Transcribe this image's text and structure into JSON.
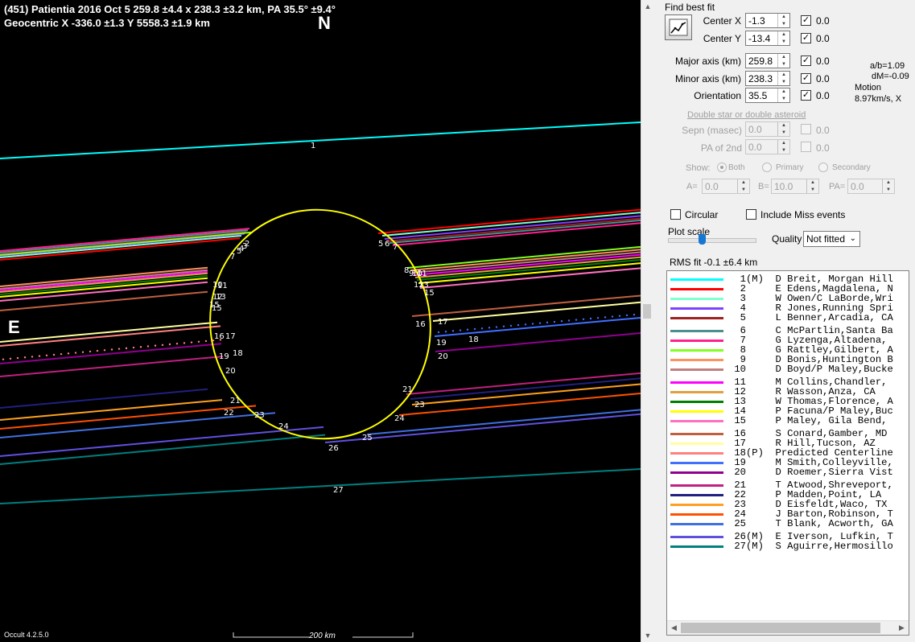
{
  "plot": {
    "title_line1": "(451) Patientia  2016 Oct 5   259.8 ±4.4 x 238.3 ±3.2 km,  PA 35.5° ±9.4°",
    "title_line2": "Geocentric  X  -336.0 ±1.3  Y 5558.3 ±1.9 km",
    "north": "N",
    "east": "E",
    "version": "Occult 4.2.5.0",
    "scale": "200 km",
    "chord_labels": [
      "1",
      "2",
      "3",
      "4",
      "5",
      "6",
      "7",
      "8",
      "9",
      "10",
      "11",
      "12",
      "13",
      "14",
      "15",
      "16",
      "17",
      "18",
      "19",
      "20",
      "21",
      "22",
      "23",
      "24",
      "25",
      "26",
      "27"
    ]
  },
  "panel": {
    "find_best_fit": "Find best fit",
    "center_x": {
      "label": "Center X",
      "value": "-1.3",
      "fit": "0.0"
    },
    "center_y": {
      "label": "Center Y",
      "value": "-13.4",
      "fit": "0.0"
    },
    "major_axis": {
      "label": "Major axis (km)",
      "value": "259.8",
      "fit": "0.0"
    },
    "minor_axis": {
      "label": "Minor axis (km)",
      "value": "238.3",
      "fit": "0.0"
    },
    "orientation": {
      "label": "Orientation",
      "value": "35.5",
      "fit": "0.0"
    },
    "ab_ratio": "a/b=1.09",
    "dm": "dM=-0.09",
    "motion_label": "Motion",
    "motion_value": "8.97km/s, X",
    "double_star_link": "Double star  or  double asteroid",
    "sepn": {
      "label": "Sepn (masec)",
      "value": "0.0",
      "fit": "0.0"
    },
    "pa2nd": {
      "label": "PA of 2nd",
      "value": "0.0",
      "fit": "0.0"
    },
    "show_label": "Show:",
    "show_options": [
      "Both",
      "Primary",
      "Secondary"
    ],
    "a_label": "A=",
    "a_value": "0.0",
    "b_label": "B=",
    "b_value": "10.0",
    "pa_label": "PA=",
    "pa_value": "0.0",
    "circular": "Circular",
    "include_miss": "Include Miss events",
    "plot_scale": "Plot scale",
    "quality_label": "Quality",
    "quality_value": "Not fitted",
    "rms_fit": "RMS fit -0.1 ±6.4 km"
  },
  "legend": [
    {
      "text": "  1(M)  D Breit, Morgan Hill",
      "color": "#00ffff"
    },
    {
      "text": "  2     E Edens,Magdalena, N",
      "color": "#ff0000"
    },
    {
      "text": "  3     W Owen/C LaBorde,Wri",
      "color": "#80ffd0"
    },
    {
      "text": "  4     R Jones,Running Spri",
      "color": "#8040ff"
    },
    {
      "text": "  5     L Benner,Arcadia, CA",
      "color": "#a02020"
    },
    {
      "text": "  6     C McPartlin,Santa Ba",
      "color": "#4a9090"
    },
    {
      "text": "  7     G Lyzenga,Altadena,",
      "color": "#ff2090"
    },
    {
      "text": "  8     G Rattley,Gilbert, A",
      "color": "#80ff20"
    },
    {
      "text": "  9     D Bonis,Huntington B",
      "color": "#ff9060"
    },
    {
      "text": " 10     D Boyd/P Maley,Bucke",
      "color": "#c08080"
    },
    {
      "text": " 11     M Collins,Chandler,",
      "color": "#ff00ff"
    },
    {
      "text": " 12     R Wasson,Anza, CA",
      "color": "#e0a040"
    },
    {
      "text": " 13     W Thomas,Florence, A",
      "color": "#008000"
    },
    {
      "text": " 14     P Facuna/P Maley,Buc",
      "color": "#ffff00"
    },
    {
      "text": " 15     P Maley, Gila Bend,",
      "color": "#ff70c0"
    },
    {
      "text": " 16     S Conard,Gamber, MD",
      "color": "#c06040"
    },
    {
      "text": " 17     R Hill,Tucson, AZ",
      "color": "#ffffa0"
    },
    {
      "text": " 18(P)  Predicted Centerline",
      "color": "#ff8080"
    },
    {
      "text": " 19     M Smith,Colleyville,",
      "color": "#4070ff"
    },
    {
      "text": " 20     D Roemer,Sierra Vist",
      "color": "#900090"
    },
    {
      "text": " 21     T Atwood,Shreveport,",
      "color": "#c02080"
    },
    {
      "text": " 22     P Madden,Point, LA",
      "color": "#202080"
    },
    {
      "text": " 23     D Eisfeldt,Waco, TX",
      "color": "#ffa020"
    },
    {
      "text": " 24     J Barton,Robinson, T",
      "color": "#ff5000"
    },
    {
      "text": " 25     T Blank, Acworth, GA",
      "color": "#4070e0"
    },
    {
      "text": " 26(M)  E Iverson, Lufkin, T",
      "color": "#6050e0"
    },
    {
      "text": " 27(M)  S Aguirre,Hermosillo",
      "color": "#008080"
    }
  ]
}
